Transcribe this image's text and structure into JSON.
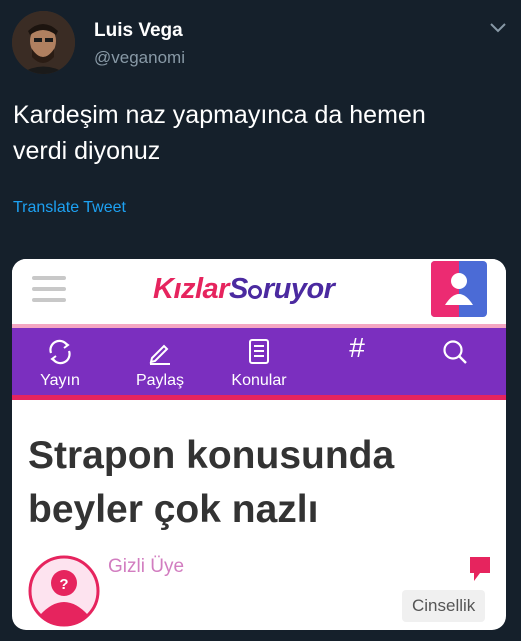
{
  "tweet": {
    "display_name": "Luis Vega",
    "handle": "@veganomi",
    "text_line1": "Kardeşim naz yapmayınca da hemen",
    "text_line2": "verdi diyonuz",
    "translate_label": "Translate Tweet"
  },
  "card": {
    "logo_part1": "Kızlar",
    "logo_part2": "S",
    "logo_part3": "ruyor",
    "nav": [
      {
        "label": "Yayın",
        "icon": "refresh-icon"
      },
      {
        "label": "Paylaş",
        "icon": "pencil-icon"
      },
      {
        "label": "Konular",
        "icon": "list-icon"
      },
      {
        "label": "",
        "icon": "hashtag-icon"
      },
      {
        "label": "",
        "icon": "search-icon"
      }
    ],
    "title_line1": "Strapon konusunda",
    "title_line2": "beyler çok nazlı",
    "author": "Gizli Üye",
    "category": "Cinsellik",
    "nav_hash_glyph": "#"
  },
  "colors": {
    "background": "#15202b",
    "link": "#1da1f2",
    "brand_pink": "#e6245e",
    "brand_purple": "#7b2fbf",
    "brand_blue": "#4b2aa0"
  }
}
